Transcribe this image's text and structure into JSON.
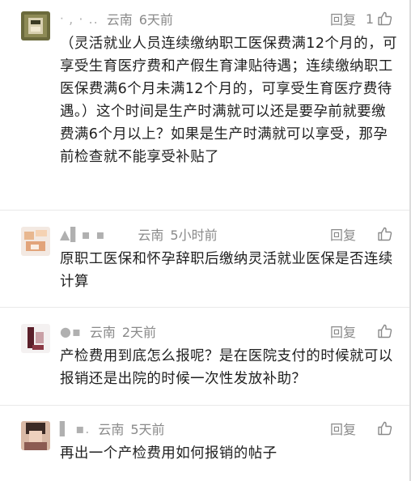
{
  "comments": [
    {
      "username": "ᐧ ,  ·  ..",
      "location": "云南",
      "time": "6天前",
      "reply_label": "回复",
      "like_count": "1",
      "text": "（灵活就业人员连续缴纳职工医保费满12个月的，可享受生育医疗费和产假生育津贴待遇；连续缴纳职工医保费满6个月未满12个月的，可享受生育医疗费待遇。）这个时间是生产时满就可以还是要孕前就要缴费满6个月以上？如果是生产时满就可以享受，那孕前检查就不能享受补贴了"
    },
    {
      "username": "▲▌▪  ▪",
      "location": "云南",
      "time": "5小时前",
      "reply_label": "回复",
      "like_count": "",
      "text": "原职工医保和怀孕辞职后缴纳灵活就业医保是否连续计算"
    },
    {
      "username": "●▪",
      "location": "云南",
      "time": "2天前",
      "reply_label": "回复",
      "like_count": "",
      "text": "产检费用到底怎么报呢？是在医院支付的时候就可以报销还是出院的时候一次性发放补助？"
    },
    {
      "username": "▌ ▪.",
      "location": "云南",
      "time": "5天前",
      "reply_label": "回复",
      "like_count": "",
      "text": "再出一个产检费用如何报销的帖子"
    }
  ],
  "colors": {
    "meta_gray": "#8a8a8a",
    "text": "#1f1f1f",
    "divider": "#e9e9e9"
  },
  "icons": {
    "like": "thumbs-up-outline-icon"
  }
}
